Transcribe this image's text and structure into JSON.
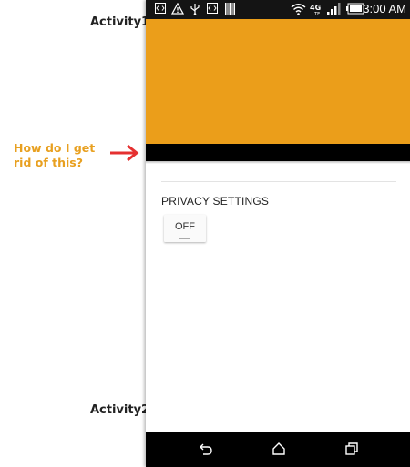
{
  "annotations": {
    "activity1_label": "Activity1",
    "activity2_label": "Activity2",
    "question": "How do I get rid of this?",
    "arrow_color": "#e53030",
    "question_color": "#e8a020"
  },
  "status_bar": {
    "time": "3:00",
    "ampm": "AM",
    "left_icons": [
      "code-icon",
      "warning-icon",
      "usb-icon",
      "code-icon",
      "barcode-icon"
    ],
    "right_icons": [
      "wifi-icon",
      "lte-icon",
      "signal-icon",
      "battery-icon"
    ]
  },
  "header": {
    "color": "#eb9e1a"
  },
  "settings": {
    "heading": "PRIVACY SETTINGS",
    "toggle_label": "OFF"
  },
  "nav_bar": {
    "buttons": [
      "back-icon",
      "home-icon",
      "recents-icon"
    ]
  }
}
